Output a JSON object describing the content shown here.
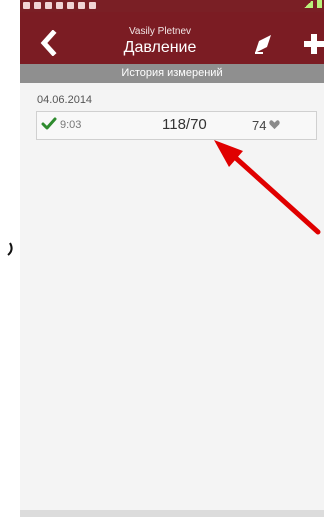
{
  "header": {
    "user_name": "Vasily Pletnev",
    "title": "Давление"
  },
  "subheader": {
    "label": "История измерений"
  },
  "measurements": [
    {
      "date": "04.06.2014",
      "time": "9:03",
      "blood_pressure": "118/70",
      "pulse": "74"
    }
  ],
  "icons": {
    "back": "back-arrow-icon",
    "edit": "edit-icon",
    "add": "add-icon",
    "check": "check-icon",
    "heart": "heart-icon"
  },
  "colors": {
    "header": "#7b1c23",
    "subheader": "#8f8f8f",
    "check": "#2e8b2e",
    "annotation_arrow": "#e00000"
  }
}
